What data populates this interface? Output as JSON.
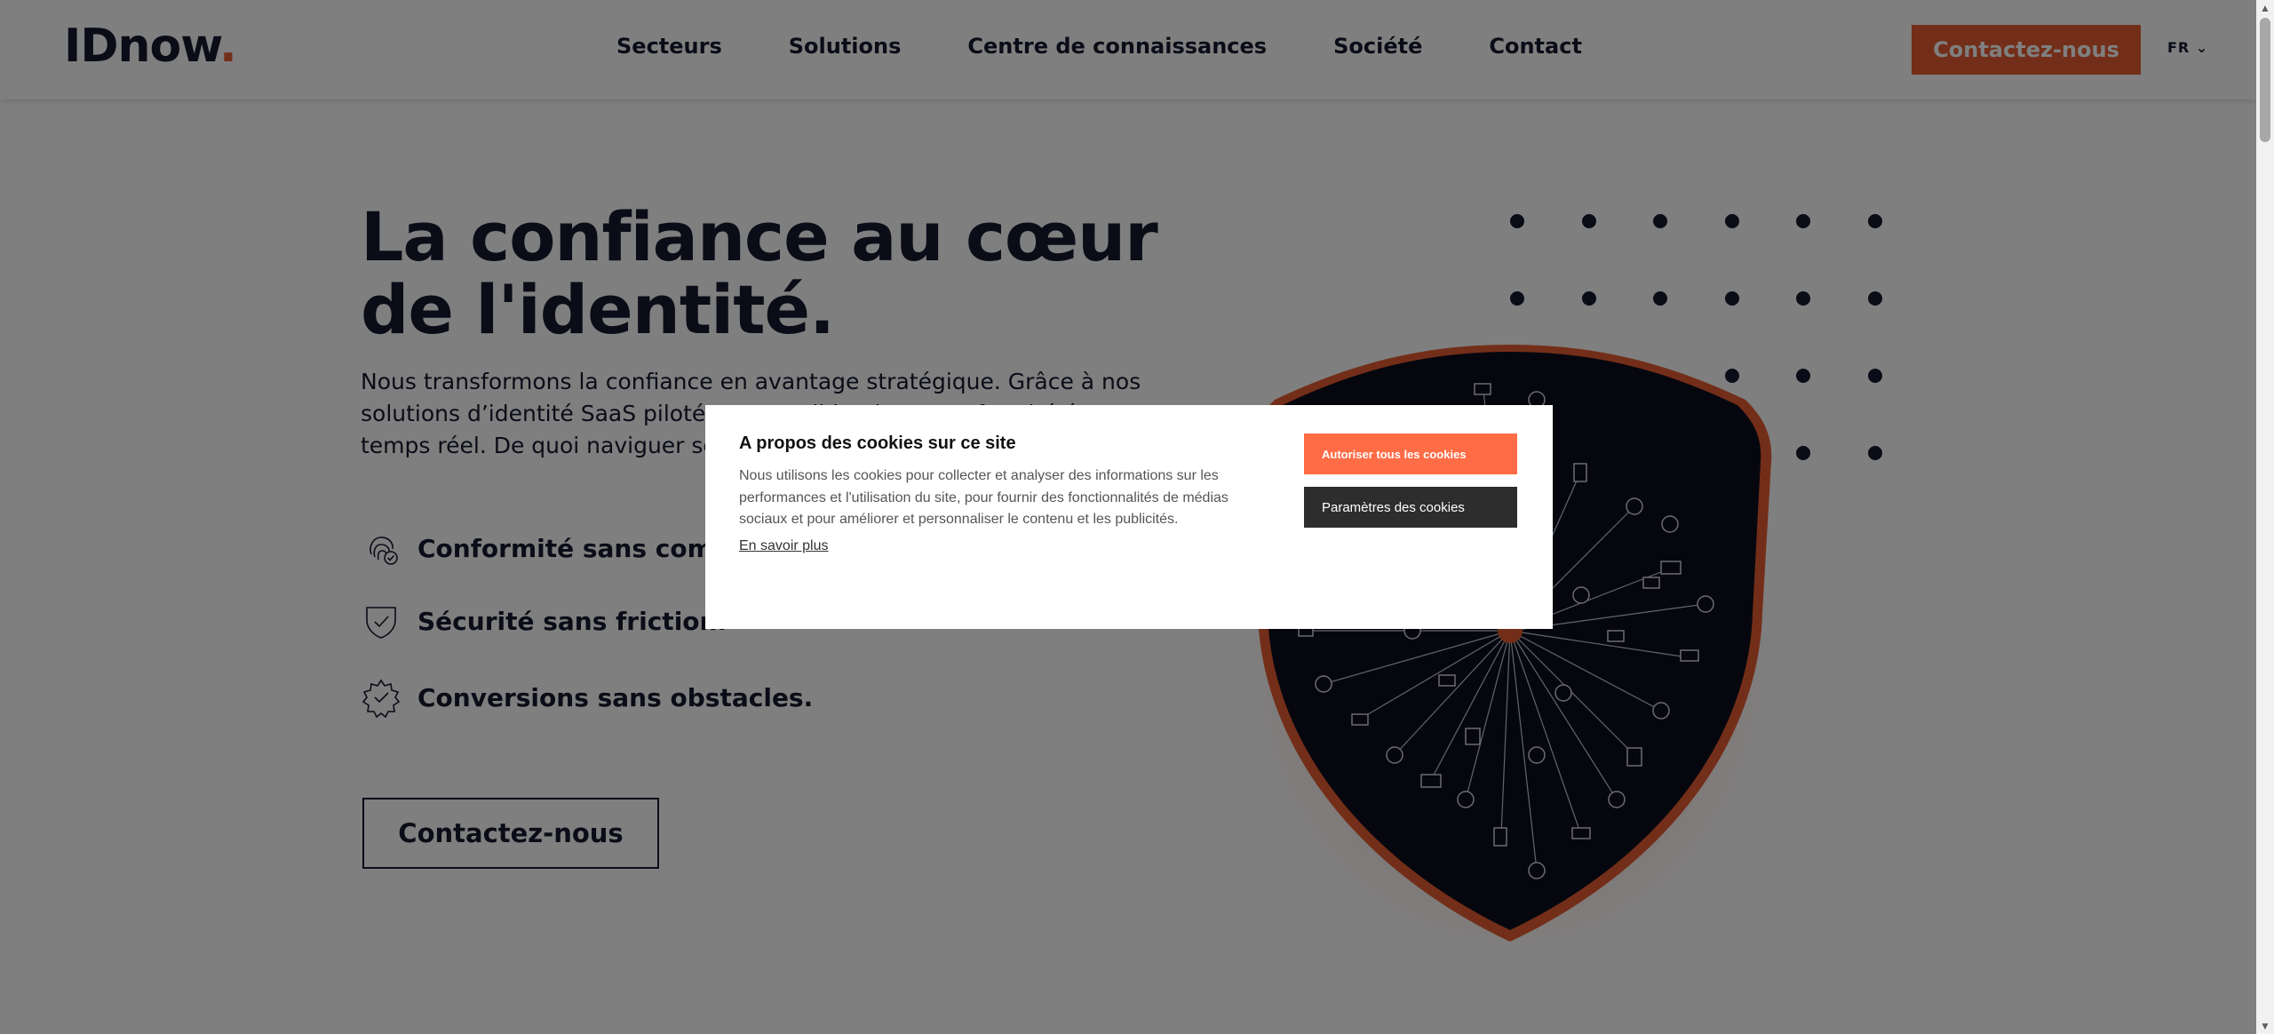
{
  "header": {
    "logo_text": "IDnow",
    "logo_dot": ".",
    "nav": [
      "Secteurs",
      "Solutions",
      "Centre de connaissances",
      "Société",
      "Contact"
    ],
    "cta_label": "Contactez-nous",
    "lang_label": "FR ⌄"
  },
  "hero": {
    "title": "La confiance au cœur de l'identité.",
    "description": "Nous transformons la confiance en avantage stratégique. Grâce à nos solutions d’identité SaaS pilotées extensible, d’une conformité év temps réel. De quoi naviguer se",
    "features": [
      "Conformité sans complex",
      "Sécurité sans friction.",
      "Conversions sans obstacles."
    ],
    "cta_label": "Contactez-nous"
  },
  "cookie_modal": {
    "title": "A propos des cookies sur ce site",
    "text": "Nous utilisons les cookies pour collecter et analyser des informations sur les performances et l'utilisation du site, pour fournir des fonctionnalités de médias sociaux et pour améliorer et personnaliser le contenu et les publicités.",
    "link_label": "En savoir plus",
    "accept_label": "Autoriser tous les cookies",
    "settings_label": "Paramètres des cookies"
  },
  "scrollbar": {
    "up_icon": "▲",
    "down_icon": "▼"
  },
  "colors": {
    "brand": "#e65c32",
    "navy": "#15182e",
    "accept": "#ff6c45",
    "settings": "#2d2d2d"
  }
}
